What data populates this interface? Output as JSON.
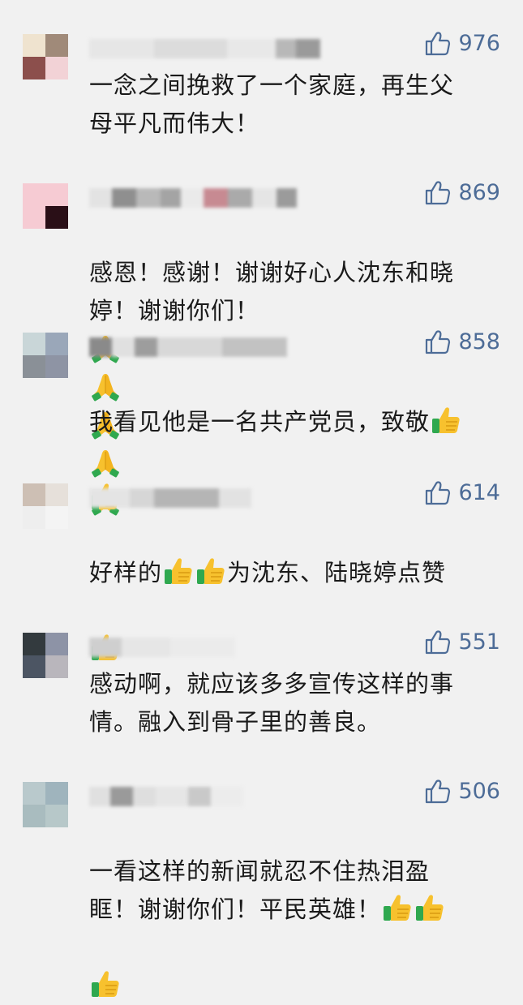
{
  "comments": [
    {
      "likes": "976",
      "text": "一念之间挽救了一个家庭，再生父\n母平凡而伟大！",
      "avatar": [
        "#efe3cf",
        "#a08a79",
        "#8c4f4c",
        "#f2d2d6"
      ],
      "emojis": []
    },
    {
      "likes": "869",
      "text": "感恩！感谢！谢谢好心人沈东和晓\n婷！谢谢你们！",
      "avatar": [
        "#f6cbd3",
        "#f6cbd3",
        "#f6cbd3",
        "#2a0f17"
      ],
      "emojis": [
        "folded-hands",
        "folded-hands",
        "folded-hands",
        "folded-hands",
        "folded-hands"
      ]
    },
    {
      "likes": "858",
      "text": "我看见他是一名共产党员，致敬",
      "avatar": [
        "#c9d6d8",
        "#9aa7b9",
        "#8a9097",
        "#8e94a4"
      ],
      "emojis": [
        "thumbs-up",
        "thumbs-up"
      ]
    },
    {
      "likes": "614",
      "text": "好样的",
      "text2": "为沈东、陆晓婷点赞",
      "avatar": [
        "#cdbfb4",
        "#e6e0da",
        "#eeeeee",
        "#f4f4f4"
      ],
      "emojis": [
        "thumbs-up",
        "thumbs-up",
        "thumbs-up"
      ]
    },
    {
      "likes": "551",
      "text": "感动啊，就应该多多宣传这样的事\n情。融入到骨子里的善良。",
      "avatar": [
        "#333a3e",
        "#8d93a6",
        "#4c5563",
        "#b9b6bc"
      ],
      "emojis": []
    },
    {
      "likes": "506",
      "text": "一看这样的新闻就忍不住热泪盈\n眶！谢谢你们！平民英雄！",
      "avatar": [
        "#b9c9cc",
        "#9fb4bd",
        "#a9bcbf",
        "#b7c8c9"
      ],
      "emojis": [
        "thumbs-up",
        "thumbs-up",
        "thumbs-up"
      ]
    }
  ],
  "colors": {
    "like_blue": "#4d6c97",
    "background": "#f1f1f1"
  }
}
